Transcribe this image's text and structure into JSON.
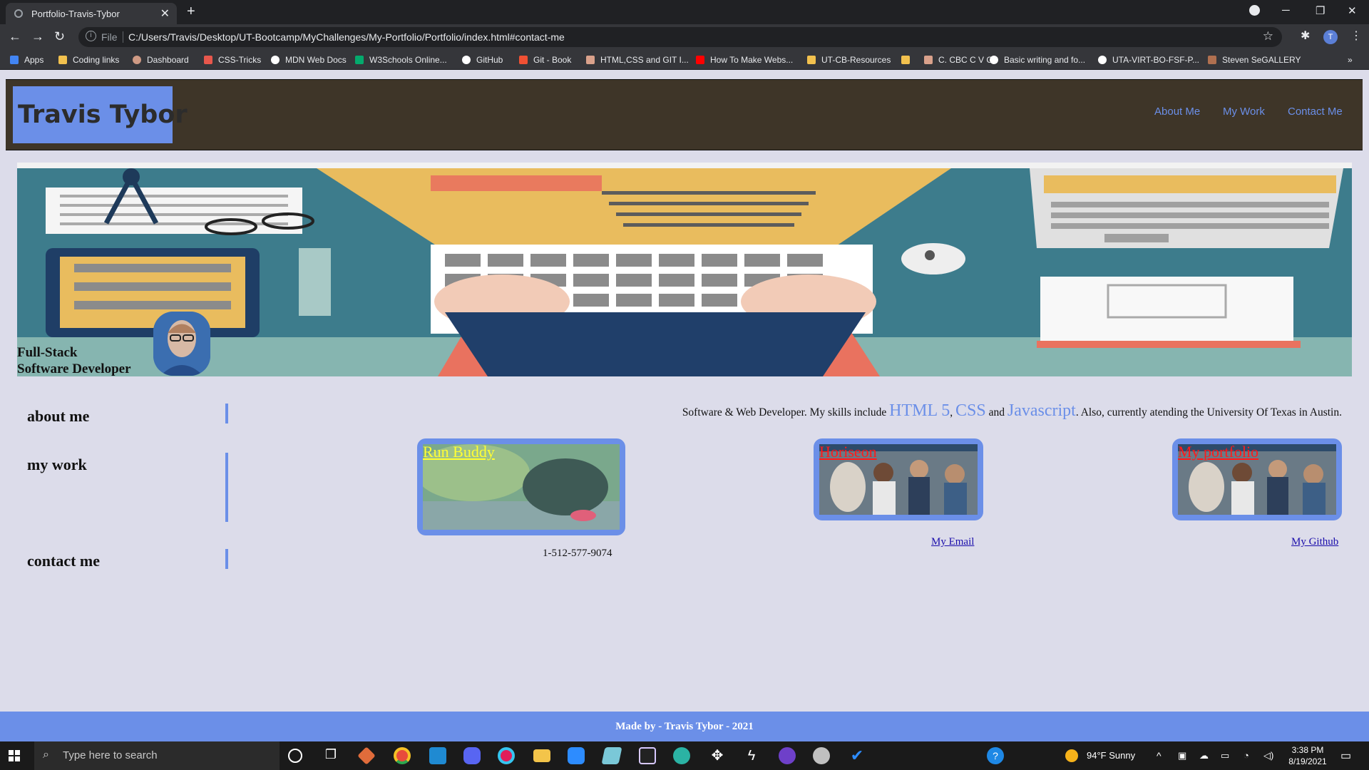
{
  "browser": {
    "tab_title": "Portfolio-Travis-Tybor",
    "file_label": "File",
    "url": "C:/Users/Travis/Desktop/UT-Bootcamp/MyChallenges/My-Portfolio/Portfolio/index.html#contact-me",
    "profile_initial": "T",
    "bookmarks": [
      {
        "label": "Apps",
        "icon": "apps-grid-icon"
      },
      {
        "label": "Coding links",
        "icon": "folder-icon"
      },
      {
        "label": "Dashboard",
        "icon": "dashboard-icon"
      },
      {
        "label": "CSS-Tricks",
        "icon": "css-tricks-icon"
      },
      {
        "label": "MDN Web Docs",
        "icon": "mdn-icon"
      },
      {
        "label": "W3Schools Online...",
        "icon": "w3schools-icon"
      },
      {
        "label": "GitHub",
        "icon": "github-icon"
      },
      {
        "label": "Git - Book",
        "icon": "git-icon"
      },
      {
        "label": "HTML,CSS and GIT I...",
        "icon": "page-icon"
      },
      {
        "label": "How To Make Webs...",
        "icon": "youtube-icon"
      },
      {
        "label": "UT-CB-Resources",
        "icon": "folder-icon"
      },
      {
        "label": "",
        "icon": "folder-icon"
      },
      {
        "label": "C. CBC C V C",
        "icon": "page-icon"
      },
      {
        "label": "Basic writing and fo...",
        "icon": "github-icon"
      },
      {
        "label": "UTA-VIRT-BO-FSF-P...",
        "icon": "github-icon"
      },
      {
        "label": "Steven SeGALLERY",
        "icon": "gallery-icon"
      }
    ]
  },
  "site": {
    "title": "Travis Tybor",
    "nav": [
      "About Me",
      "My Work",
      "Contact Me"
    ],
    "hero_line1": "Full-Stack",
    "hero_line2": "Software Developer",
    "sections": {
      "about": "about me",
      "work": "my work",
      "contact": "contact me"
    },
    "about": {
      "pre": "Software & Web Developer. My skills include ",
      "skill1": "HTML 5",
      "comma": ", ",
      "skill2": "CSS",
      "and": " and ",
      "skill3": "Javascript",
      "post": ". Also, currently atending the University Of Texas in Austin."
    },
    "projects": [
      {
        "title": "Run Buddy",
        "title_color": "#ffff33"
      },
      {
        "title": "Horiseon",
        "title_color": "#ff1a1a"
      },
      {
        "title": "My portfolio",
        "title_color": "#ff1a1a"
      }
    ],
    "contact": {
      "phone": "1-512-577-9074",
      "email": "My Email",
      "github": "My Github"
    },
    "footer": "Made by - Travis Tybor - 2021",
    "accent": "#6b8fe8",
    "header_bg": "#3e3528"
  },
  "taskbar": {
    "search_placeholder": "Type here to search",
    "weather": "94°F  Sunny",
    "time": "3:38 PM",
    "date": "8/19/2021"
  }
}
